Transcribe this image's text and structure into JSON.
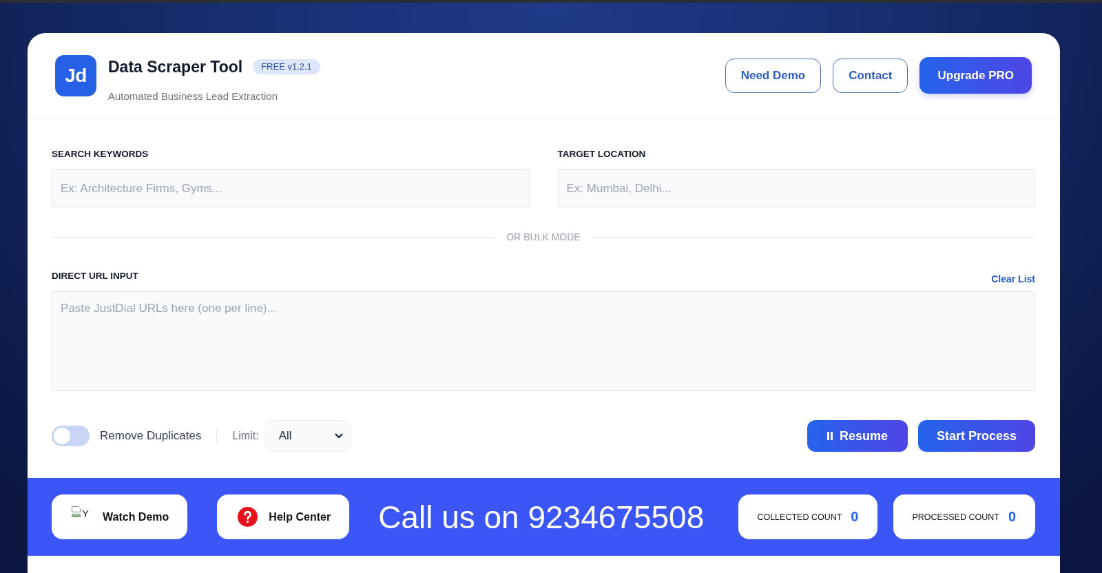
{
  "header": {
    "logo": "Jd",
    "title": "Data Scraper Tool",
    "badge": "FREE v1.2.1",
    "subtitle": "Automated Business Lead Extraction",
    "buttons": [
      {
        "label": "Need Demo",
        "kind": "outline"
      },
      {
        "label": "Contact",
        "kind": "outline"
      },
      {
        "label": "Upgrade PRO",
        "kind": "primary"
      }
    ]
  },
  "search": {
    "fields": [
      {
        "label": "SEARCH KEYWORDS",
        "placeholder": "Ex: Architecture Firms, Gyms..."
      },
      {
        "label": "TARGET LOCATION",
        "placeholder": "Ex: Mumbai, Delhi..."
      }
    ]
  },
  "divider": "OR BULK MODE",
  "url_input": {
    "label": "DIRECT URL INPUT",
    "action": "Clear List",
    "placeholder": "Paste JustDial URLs here (one per line)..."
  },
  "options": {
    "remove_duplicates": {
      "label": "Remove Duplicates",
      "on": false
    },
    "limit": {
      "label": "Limit:",
      "value": "All"
    }
  },
  "actions": [
    {
      "label": "Resume",
      "kind": "pause"
    },
    {
      "label": "Start Process",
      "kind": "plain"
    }
  ],
  "footer": {
    "links": [
      {
        "label": "Watch Demo",
        "kind": "image",
        "alt_text": "Y"
      },
      {
        "label": "Help Center",
        "kind": "help"
      }
    ],
    "call_text": "Call us on 9234675508",
    "counters": [
      {
        "label": "COLLECTED COUNT",
        "value": "0"
      },
      {
        "label": "PROCESSED COUNT",
        "value": "0"
      }
    ]
  }
}
